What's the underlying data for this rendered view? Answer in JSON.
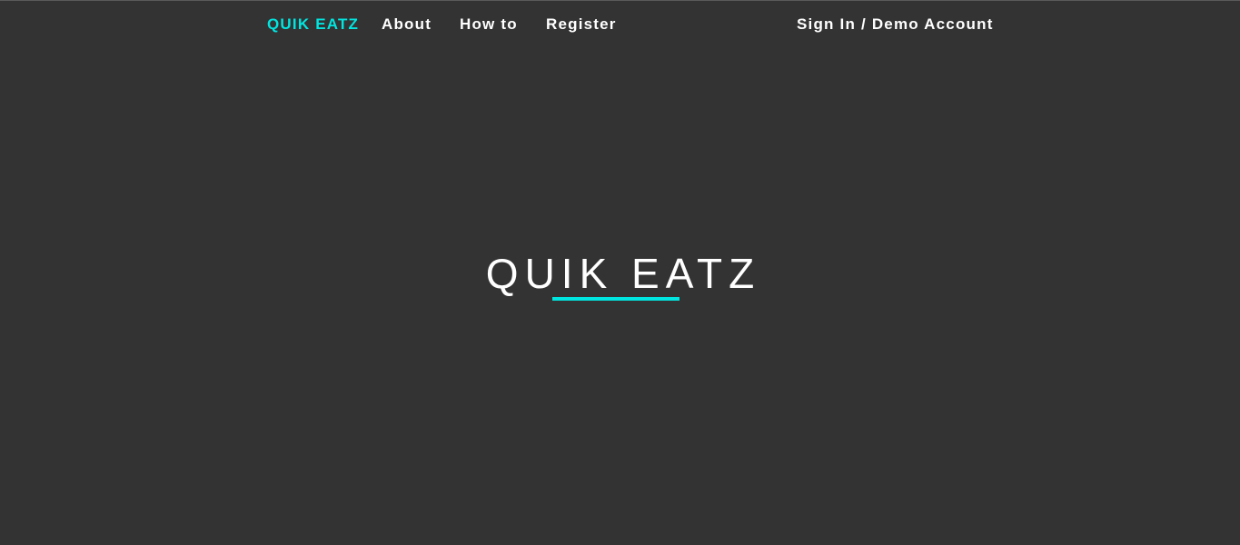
{
  "nav": {
    "brand": "QUIK EATZ",
    "about": "About",
    "how_to": "How to",
    "register": "Register",
    "sign_in": "Sign In / Demo Account"
  },
  "hero": {
    "title": "QUIK EATZ"
  },
  "colors": {
    "background": "#333333",
    "accent": "#00e5e0",
    "text": "#ffffff"
  }
}
